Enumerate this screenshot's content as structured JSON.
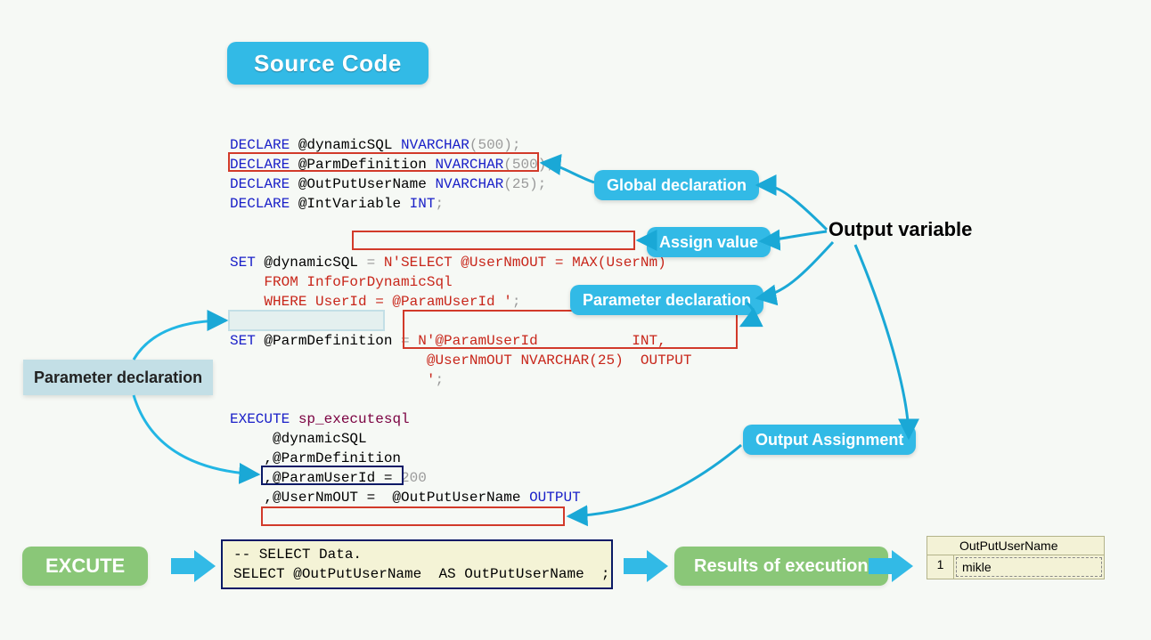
{
  "title": "Source Code",
  "badges": {
    "global_declaration": "Global declaration",
    "assign_value": "Assign value",
    "parameter_declaration": "Parameter declaration",
    "output_assignment": "Output Assignment",
    "output_variable": "Output variable"
  },
  "left_label": "Parameter declaration",
  "code": {
    "l1": {
      "kw": "DECLARE",
      "var": " @dynamicSQL ",
      "type": "NVARCHAR",
      "open": "(",
      "num": "500",
      "close": ");"
    },
    "l2": {
      "kw": "DECLARE",
      "var": " @ParmDefinition ",
      "type": "NVARCHAR",
      "open": "(",
      "num": "500",
      "close": ");"
    },
    "l3": {
      "kw": "DECLARE",
      "var": " @OutPutUserName ",
      "type": "NVARCHAR",
      "open": "(",
      "num": "25",
      "close": ");"
    },
    "l4": {
      "kw": "DECLARE",
      "var": " @IntVariable ",
      "type": "INT",
      "end": ";"
    },
    "l6a": {
      "kw": "SET",
      "var": " @dynamicSQL ",
      "eq": "="
    },
    "l6b": " N'SELECT @UserNmOUT = MAX(UserNm)",
    "l7": "    FROM InfoForDynamicSql",
    "l8": "    WHERE UserId = @ParamUserId '",
    "l8end": ";",
    "l10a": {
      "kw": "SET",
      "var": " @ParmDefinition",
      "eq": " = "
    },
    "l10b": "N'@ParamUserId           INT,",
    "l11": "                       @UserNmOUT NVARCHAR(25)  OUTPUT",
    "l12": "                       '",
    "l12end": ";",
    "l14": {
      "kw": "EXECUTE",
      "sp": " sp_executesql"
    },
    "l15": "     @dynamicSQL",
    "l16": "    ,@ParmDefinition",
    "l17pre": "    ,@ParamUserId = ",
    "l17num": "200",
    "l18pre": "    ,@UserNmOUT =  @OutPutUserName ",
    "l18kw": "OUTPUT"
  },
  "bottom": {
    "execute": "EXCUTE",
    "select_comment": "-- SELECT Data.",
    "select_kw": "SELECT",
    "select_rest": " @OutPutUserName  ",
    "as_kw": "AS",
    "alias": " OutPutUserName  ",
    "semi": ";",
    "results_label": "Results of execution"
  },
  "result": {
    "header": "OutPutUserName",
    "row_num": "1",
    "value": "mikle"
  }
}
